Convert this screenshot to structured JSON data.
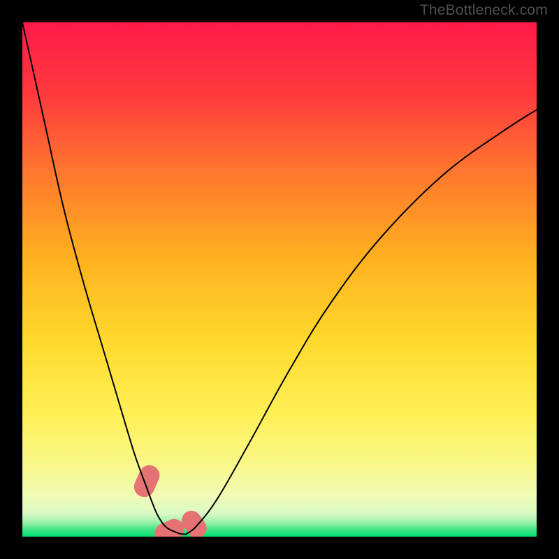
{
  "watermark": "TheBottleneck.com",
  "chart_data": {
    "type": "line",
    "title": "",
    "xlabel": "",
    "ylabel": "",
    "xlim": [
      0,
      100
    ],
    "ylim": [
      0,
      100
    ],
    "grid": false,
    "background": {
      "gradient": [
        "#ff1744",
        "#ff6d2e",
        "#ffb300",
        "#ffe24a",
        "#fff176",
        "#fff9b0",
        "#00e676"
      ],
      "direction": "top-to-bottom"
    },
    "series": [
      {
        "name": "curve",
        "stroke": "#000000",
        "x": [
          0,
          4,
          8,
          12,
          16,
          20,
          22,
          24,
          25.5,
          26.5,
          28,
          30,
          31,
          31.5,
          32,
          34,
          38,
          44,
          52,
          60,
          70,
          82,
          94,
          100
        ],
        "values": [
          100,
          82,
          64,
          49,
          35.5,
          22,
          15.5,
          10,
          6,
          3.8,
          1.8,
          0.8,
          0.5,
          0.5,
          0.6,
          2.2,
          7.5,
          18,
          32.5,
          45.5,
          58.5,
          70.5,
          79.2,
          83
        ]
      }
    ],
    "markers": [
      {
        "name": "marker-left-upper",
        "shape": "rounded-capsule",
        "color": "#e57373",
        "cx": 24.2,
        "cy": 10.8,
        "angle_deg": -66,
        "length": 6.4,
        "thickness": 4.0
      },
      {
        "name": "marker-bottom-left",
        "shape": "rounded-capsule",
        "color": "#e57373",
        "cx": 28.6,
        "cy": 1.0,
        "angle_deg": -25,
        "length": 6.0,
        "thickness": 4.0
      },
      {
        "name": "marker-bottom-right",
        "shape": "rounded-capsule",
        "color": "#e57373",
        "cx": 33.4,
        "cy": 2.4,
        "angle_deg": 55,
        "length": 5.6,
        "thickness": 3.8
      }
    ]
  }
}
